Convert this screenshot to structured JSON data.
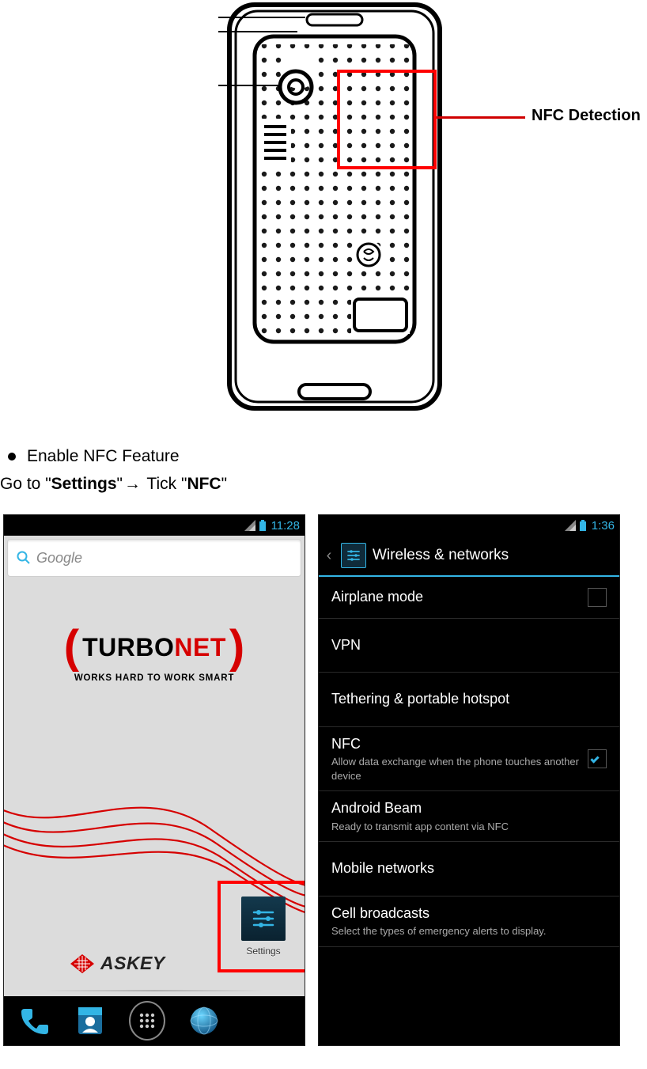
{
  "diagram": {
    "callout_label": "NFC Detection"
  },
  "doc": {
    "bullet_text": "Enable NFC Feature",
    "inst_prefix": "Go to \"",
    "inst_settings": "Settings",
    "inst_mid": "\"",
    "inst_tick": " Tick \"",
    "inst_nfc": "NFC",
    "inst_suffix": "\""
  },
  "home": {
    "statusbar_time": "11:28",
    "search_placeholder": "Google",
    "turbonet_word1": "TURBO",
    "turbonet_word2": "NET",
    "tagline": "WORKS HARD TO WORK SMART",
    "settings_label": "Settings",
    "askey_brand": "ASKEY"
  },
  "settings": {
    "statusbar_time": "1:36",
    "header_title": "Wireless & networks",
    "items": [
      {
        "title": "Airplane mode",
        "sub": "",
        "checkbox": "unchecked"
      },
      {
        "title": "VPN",
        "sub": "",
        "checkbox": ""
      },
      {
        "title": "Tethering & portable hotspot",
        "sub": "",
        "checkbox": ""
      },
      {
        "title": "NFC",
        "sub": "Allow data exchange when the phone touches another device",
        "checkbox": "checked"
      },
      {
        "title": "Android Beam",
        "sub": "Ready to transmit app content via NFC",
        "checkbox": ""
      },
      {
        "title": "Mobile networks",
        "sub": "",
        "checkbox": ""
      },
      {
        "title": "Cell broadcasts",
        "sub": "Select the types of emergency alerts to display.",
        "checkbox": ""
      }
    ]
  }
}
